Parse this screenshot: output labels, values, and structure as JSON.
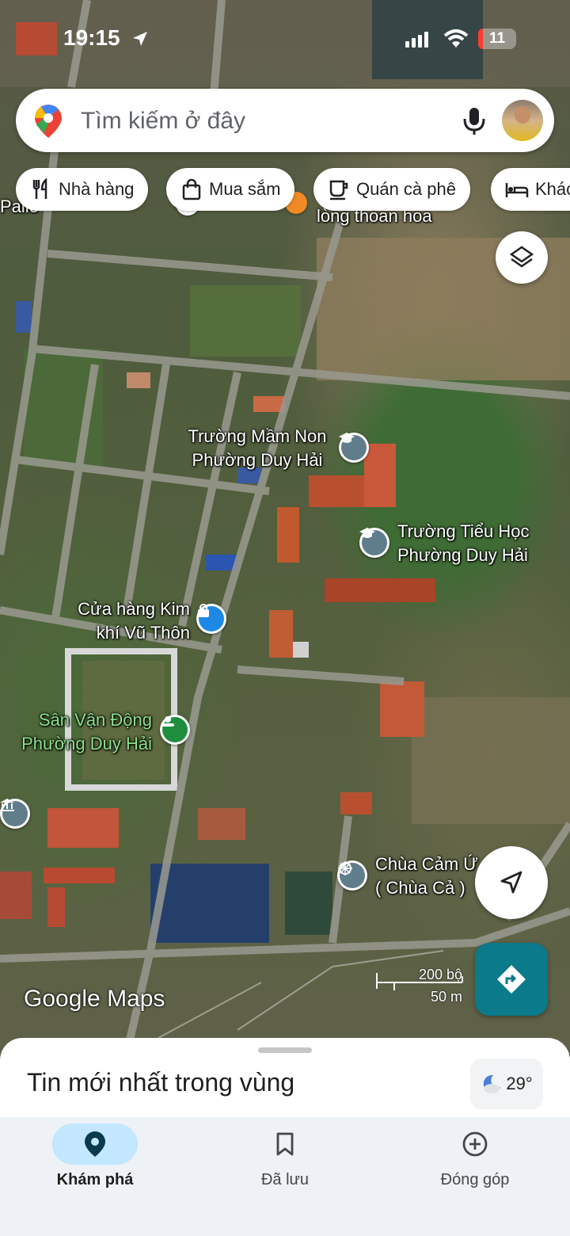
{
  "status_bar": {
    "time": "19:15",
    "battery": "11",
    "icons": [
      "location-arrow-icon",
      "signal-icon",
      "wifi-icon",
      "battery-icon"
    ]
  },
  "search": {
    "placeholder": "Tìm kiếm ở đây",
    "icons": [
      "maps-pin-icon",
      "microphone-icon",
      "avatar"
    ]
  },
  "chips": [
    {
      "label": "Nhà hàng",
      "icon": "restaurant-icon"
    },
    {
      "label": "Mua sắm",
      "icon": "shopping-bag-icon"
    },
    {
      "label": "Quán cà phê",
      "icon": "coffee-icon"
    },
    {
      "label": "Khác",
      "icon": "bed-icon"
    }
  ],
  "map_labels": {
    "partial_top_left": "Palle",
    "partial_top": "lòng thoan hoa",
    "kindergarten": [
      "Trường Mầm Non",
      "Phường Duy Hải"
    ],
    "primary_school": [
      "Trường Tiểu Học",
      "Phường Duy Hải"
    ],
    "hardware_store": [
      "Cửa hàng Kim",
      "khí Vũ Thôn"
    ],
    "stadium": [
      "Sân Vận Động",
      "Phường Duy Hải"
    ],
    "pagoda": [
      "Chùa Cảm Ứ",
      "( Chùa Cả )"
    ]
  },
  "map_brand": "Google Maps",
  "scale": {
    "imperial": "200 bộ",
    "metric": "50 m"
  },
  "sheet": {
    "title": "Tin mới nhất trong vùng",
    "temperature": "29°"
  },
  "nav": [
    {
      "label": "Khám phá",
      "icon": "explore-pin-icon",
      "active": true
    },
    {
      "label": "Đã lưu",
      "icon": "bookmark-icon",
      "active": false
    },
    {
      "label": "Đóng góp",
      "icon": "add-circle-icon",
      "active": false
    }
  ],
  "colors": {
    "accent": "#0b7a8a",
    "active_pill": "#c2e7ff",
    "school_poi": "#607d8b",
    "shopping_poi": "#1e88e5",
    "park_poi": "#1e8e3e"
  }
}
